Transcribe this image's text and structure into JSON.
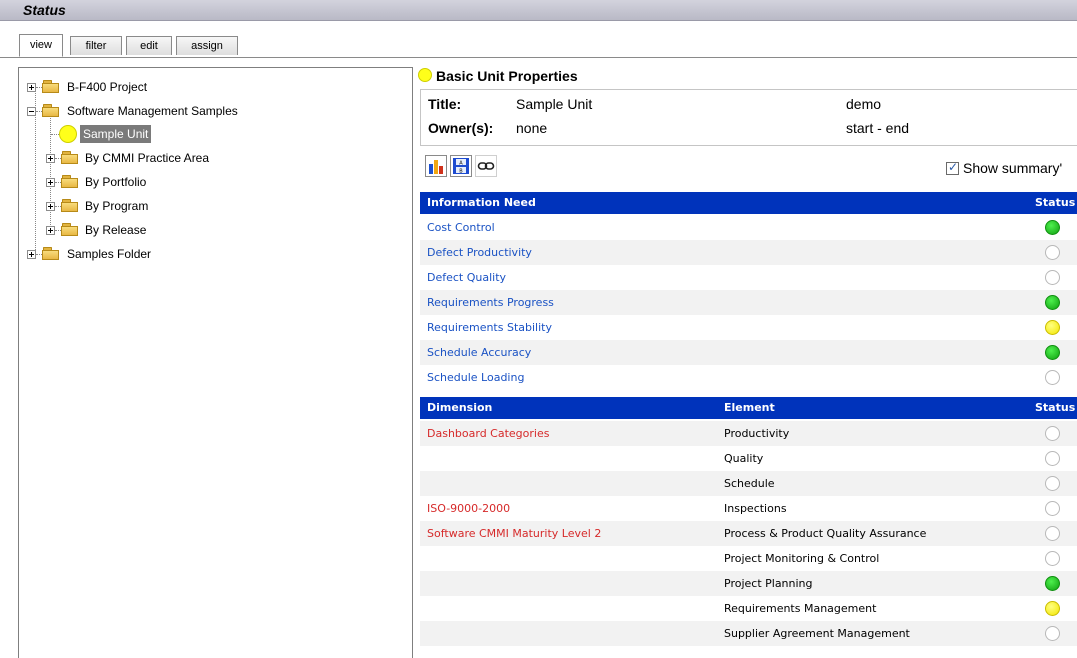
{
  "window": {
    "title": "Status"
  },
  "tabs": [
    {
      "label": "view",
      "active": true
    },
    {
      "label": "filter",
      "active": false
    },
    {
      "label": "edit",
      "active": false
    },
    {
      "label": "assign",
      "active": false
    }
  ],
  "tree": {
    "nodes": [
      {
        "label": "B-F400 Project",
        "expander": "plus"
      },
      {
        "label": "Software Management Samples",
        "expander": "minus"
      },
      {
        "label": "Sample Unit",
        "selected": true,
        "status_color": "#ffff1a"
      },
      {
        "label": "By CMMI Practice Area",
        "expander": "plus"
      },
      {
        "label": "By Portfolio",
        "expander": "plus"
      },
      {
        "label": "By Program",
        "expander": "plus"
      },
      {
        "label": "By Release",
        "expander": "plus"
      },
      {
        "label": "Samples Folder",
        "expander": "plus"
      }
    ]
  },
  "properties": {
    "heading": "Basic Unit Properties",
    "title_label": "Title:",
    "title_value": "Sample Unit",
    "owner_label": "Owner(s):",
    "owner_value": "none",
    "extra_value_1": "demo",
    "extra_value_2": "start - end"
  },
  "toolbar": {
    "icons": [
      "bar-chart-icon",
      "table-view-icon",
      "link-icon"
    ],
    "show_summary_label": "Show summary'",
    "show_summary_checked": true
  },
  "information_table": {
    "headers": {
      "need": "Information Need",
      "status": "Status"
    },
    "rows": [
      {
        "need": "Cost Control",
        "status": "green"
      },
      {
        "need": "Defect Productivity",
        "status": "empty"
      },
      {
        "need": "Defect Quality",
        "status": "empty"
      },
      {
        "need": "Requirements Progress",
        "status": "green"
      },
      {
        "need": "Requirements Stability",
        "status": "yellow"
      },
      {
        "need": "Schedule Accuracy",
        "status": "green"
      },
      {
        "need": "Schedule Loading",
        "status": "empty"
      }
    ]
  },
  "dimension_table": {
    "headers": {
      "dimension": "Dimension",
      "element": "Element",
      "status": "Status"
    },
    "rows": [
      {
        "dimension": "Dashboard Categories",
        "element": "Productivity",
        "status": "empty"
      },
      {
        "dimension": "",
        "element": "Quality",
        "status": "empty"
      },
      {
        "dimension": "",
        "element": "Schedule",
        "status": "empty"
      },
      {
        "dimension": "ISO-9000-2000",
        "element": "Inspections",
        "status": "empty"
      },
      {
        "dimension": "Software CMMI Maturity Level 2",
        "element": "Process & Product Quality Assurance",
        "status": "empty"
      },
      {
        "dimension": "",
        "element": "Project Monitoring & Control",
        "status": "empty"
      },
      {
        "dimension": "",
        "element": "Project Planning",
        "status": "green"
      },
      {
        "dimension": "",
        "element": "Requirements Management",
        "status": "yellow"
      },
      {
        "dimension": "",
        "element": "Supplier Agreement Management",
        "status": "empty"
      }
    ]
  },
  "colors": {
    "header_blue": "#0033bb",
    "link_blue": "#1a52c4",
    "link_red": "#d62a2a",
    "status_green": "#10a010",
    "status_yellow": "#f3e600"
  }
}
